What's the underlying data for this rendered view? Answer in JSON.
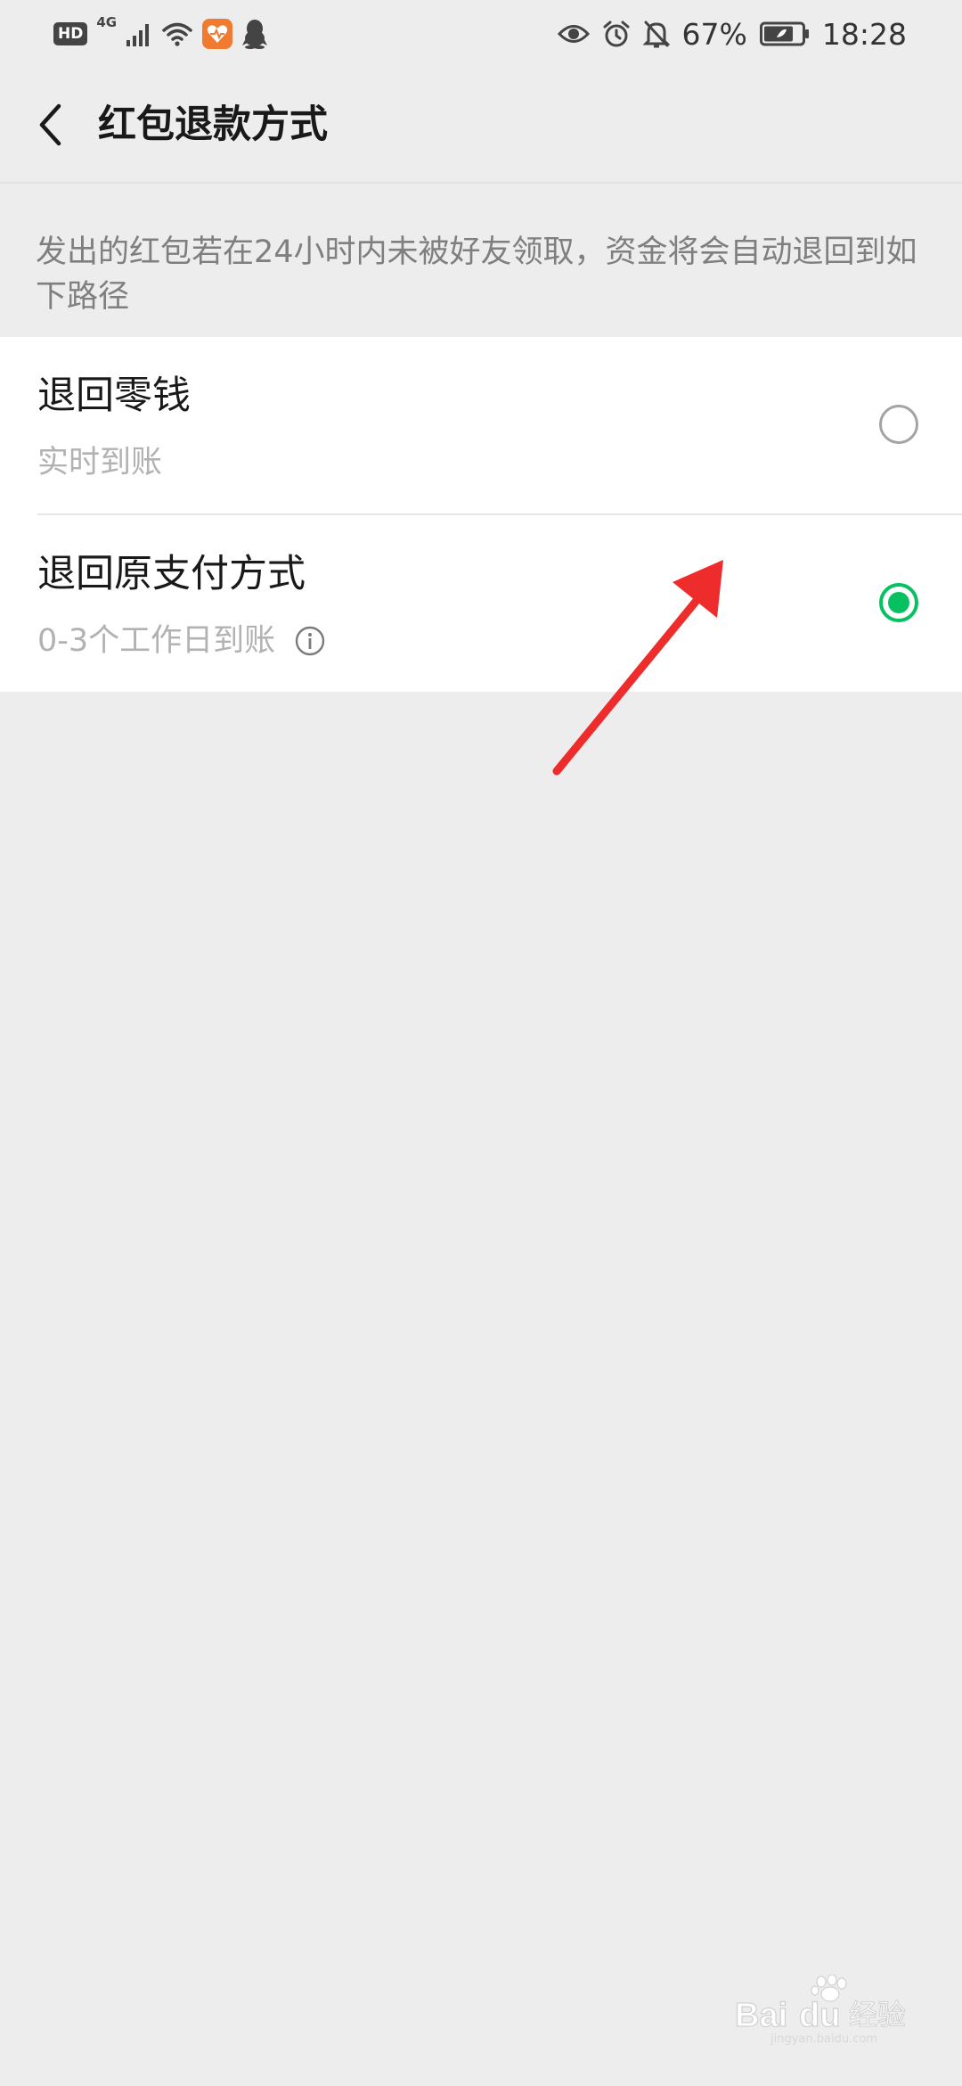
{
  "status_bar": {
    "hd": "HD",
    "network": "4G",
    "battery_percent": "67%",
    "time": "18:28",
    "icons": [
      "signal-icon",
      "wifi-icon",
      "health-app-icon",
      "qq-icon",
      "eye-icon",
      "alarm-icon",
      "mute-icon",
      "battery-icon"
    ]
  },
  "nav": {
    "title": "红包退款方式",
    "back_icon": "back-chevron-icon"
  },
  "notice": "发出的红包若在24小时内未被好友领取，资金将会自动退回到如下路径",
  "options": [
    {
      "title": "退回零钱",
      "subtitle": "实时到账",
      "selected": false
    },
    {
      "title": "退回原支付方式",
      "subtitle": "0-3个工作日到账",
      "selected": true,
      "info_icon": "info-icon"
    }
  ],
  "colors": {
    "accent": "#07c160",
    "background": "#ededed",
    "annotation_arrow": "#ee2c2c"
  },
  "watermark": {
    "brand": "Bai",
    "brand_du": "du",
    "suffix": "经验",
    "url": "jingyan.baidu.com"
  }
}
